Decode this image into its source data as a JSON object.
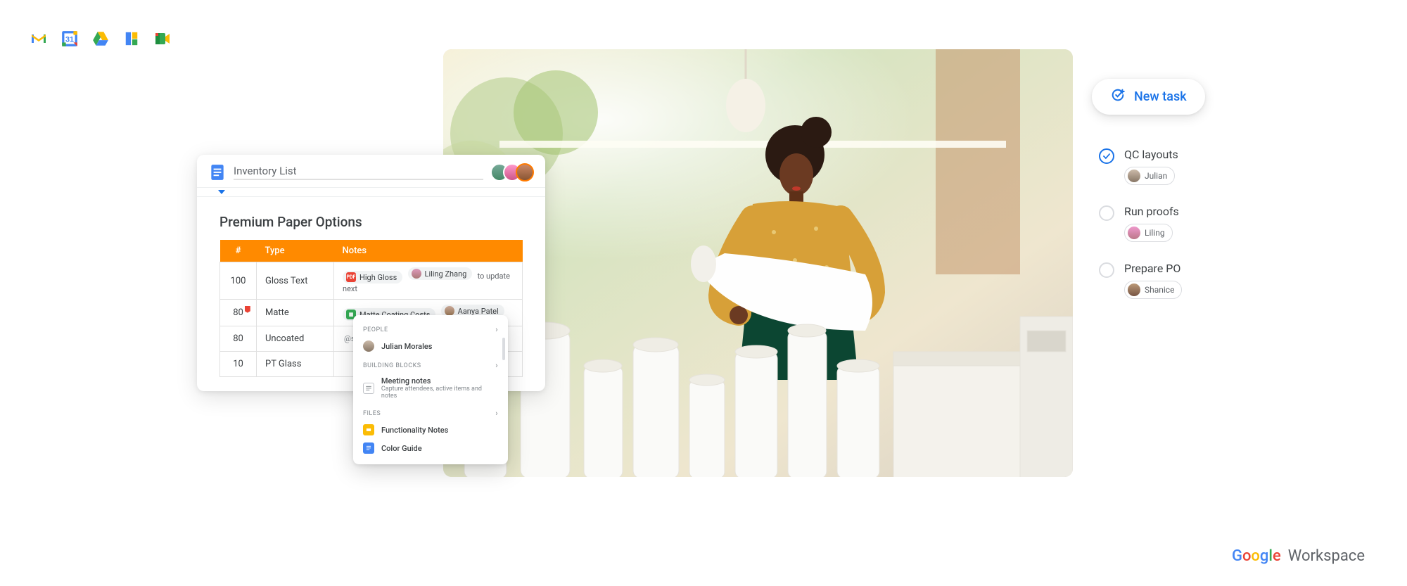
{
  "docs": {
    "title": "Inventory List",
    "heading": "Premium Paper Options",
    "columns": [
      "#",
      "Type",
      "Notes"
    ],
    "rows": [
      {
        "qty": "100",
        "type": "Gloss Text",
        "chips": [
          {
            "kind": "pdf",
            "label": "High Gloss"
          },
          {
            "kind": "person",
            "label": "Liling Zhang"
          }
        ],
        "trailing": "to update next"
      },
      {
        "qty": "80",
        "flagged": true,
        "type": "Matte",
        "chips": [
          {
            "kind": "sheets",
            "label": "Matte Coating Costs"
          },
          {
            "kind": "person",
            "label": "Aanya Patel"
          }
        ]
      },
      {
        "qty": "80",
        "type": "Uncoated",
        "search": "@search menu"
      },
      {
        "qty": "10",
        "type": "PT Glass"
      }
    ]
  },
  "dropdown": {
    "sections": {
      "people": {
        "label": "PEOPLE",
        "item": "Julian Morales"
      },
      "blocks": {
        "label": "BUILDING BLOCKS",
        "title": "Meeting notes",
        "sub": "Capture attendees, active items and notes"
      },
      "files": {
        "label": "FILES",
        "items": [
          "Functionality Notes",
          "Color Guide"
        ]
      }
    }
  },
  "newTask": {
    "label": "New task"
  },
  "tasks": [
    {
      "title": "QC layouts",
      "done": true,
      "assignee": "Julian"
    },
    {
      "title": "Run proofs",
      "done": false,
      "assignee": "Liling"
    },
    {
      "title": "Prepare PO",
      "done": false,
      "assignee": "Shanice"
    }
  ],
  "branding": {
    "google": "Google",
    "workspace": "Workspace"
  }
}
